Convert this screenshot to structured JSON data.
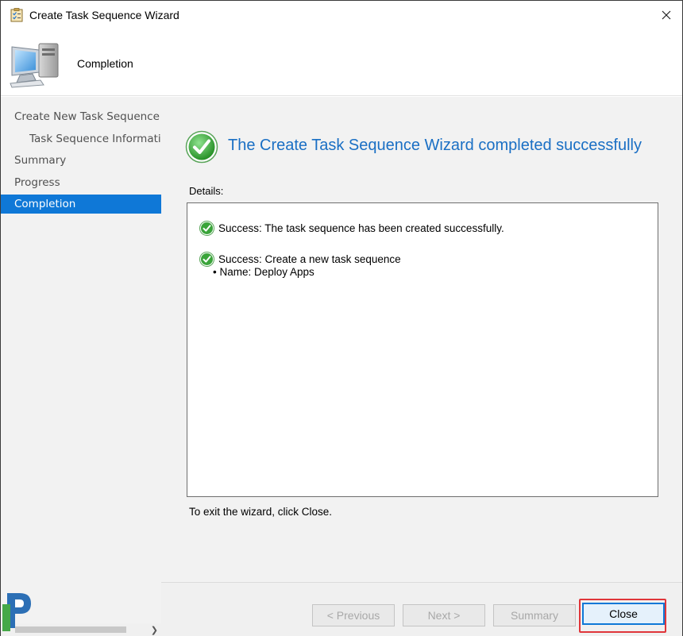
{
  "window": {
    "title": "Create Task Sequence Wizard",
    "icons": {
      "title": "clipboard-checklist-icon",
      "close": "close-icon",
      "header": "computer-icon"
    }
  },
  "header": {
    "title": "Completion"
  },
  "sidebar": {
    "items": [
      {
        "label": "Create New Task Sequence",
        "level": 0,
        "active": false
      },
      {
        "label": "Task Sequence Information",
        "level": 1,
        "active": false
      },
      {
        "label": "Summary",
        "level": 0,
        "active": false
      },
      {
        "label": "Progress",
        "level": 0,
        "active": false
      },
      {
        "label": "Completion",
        "level": 0,
        "active": true
      }
    ]
  },
  "content": {
    "heading": "The Create Task Sequence Wizard completed successfully",
    "details_label": "Details:",
    "details": [
      {
        "icon": "success-check-icon",
        "text": "Success: The task sequence has been created successfully."
      },
      {
        "icon": "success-check-icon",
        "text": "Success: Create a new task sequence",
        "sub": "• Name: Deploy Apps"
      }
    ],
    "exit_text": "To exit the wizard, click Close."
  },
  "footer": {
    "previous": "< Previous",
    "next": "Next >",
    "summary": "Summary",
    "close": "Close"
  },
  "colors": {
    "accent": "#0f78d7",
    "heading": "#1a6fc4",
    "success": "#3aa43a",
    "highlight": "#e0353a"
  }
}
